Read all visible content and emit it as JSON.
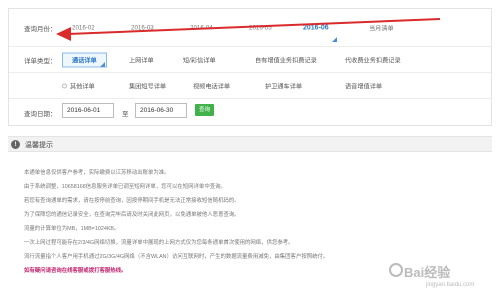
{
  "filters": {
    "month_label": "查询月份：",
    "months": [
      {
        "label": "2016-02",
        "active": false
      },
      {
        "label": "2016-03",
        "active": false
      },
      {
        "label": "2016-04",
        "active": false
      },
      {
        "label": "2016-05",
        "active": false
      },
      {
        "label": "2016-06",
        "active": true
      },
      {
        "label": "当月清单",
        "active": false
      }
    ],
    "detail_type_label": "详单类型：",
    "detail_types_row1": [
      "通话详单",
      "上网详单",
      "短/彩信详单",
      "自有增值业务扣费记录",
      "代收费业务扣费记录"
    ],
    "detail_types_row2": [
      "其他详单",
      "集团短号详单",
      "视频电话详单",
      "护卫通车详单",
      "语音增值详单"
    ],
    "date_label": "查询日期：",
    "start_date": "2016-06-01",
    "to_label": "至",
    "end_date": "2016-06-30",
    "query_button": "查询"
  },
  "tips": {
    "title": "温馨提示",
    "items": [
      "本通单信息仅供客户参考，实际缴费以江苏移动出账单为准。",
      "由于系统调整，10658168信息服务详单已调至短网详单，您可以在短网详单中查询。",
      "若您有查询通单的需求，请在按停前查询，因按停期间手机是无法正常接收短信随机码的。",
      "为了保障您的通信记录安全，在查询完毕后请及时关闭此网页，以免通单被他人恶意查询。",
      "流量的计算单位为MB，1MB=1024KB。",
      "一次上网过程可能存在2/3/4G网络切换，流量详单中展现的上网方式仅为您每条通单首次使用的网络，供您参考。",
      "流行流量指个人客户用手机通过2G/3G/4G网络（不含WLAN）访问互联网时，产生的数据流量费用减免，由集团客户按照统付。",
      "如有疑问请咨询在线客服或拨打客服热线。"
    ]
  },
  "watermark": {
    "brand": "Bai经验",
    "url": "jingyan.baidu.com"
  },
  "colors": {
    "accent": "#2e78c2",
    "query_button": "#41b14a",
    "annotation_arrow": "#d92b2b",
    "pink_tip": "#c2236e"
  }
}
